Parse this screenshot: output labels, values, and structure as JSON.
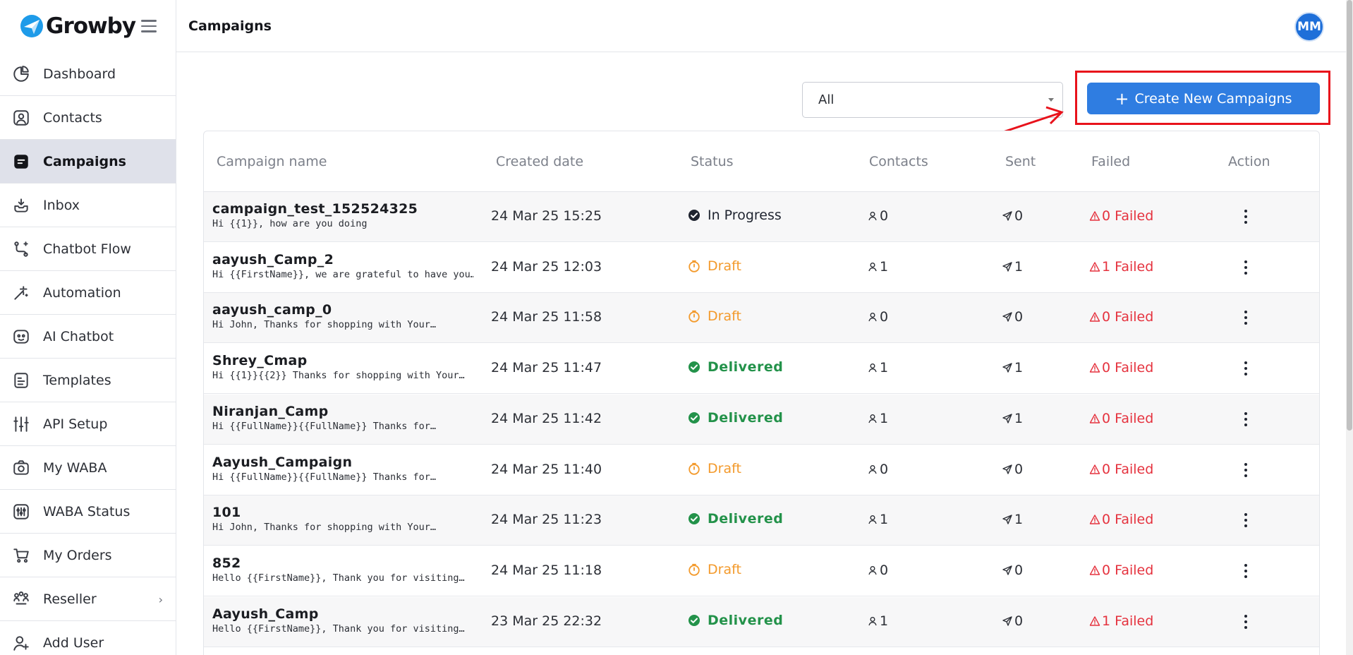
{
  "brand": {
    "name": "Growby",
    "logo_icon": "growby-logo-icon"
  },
  "sidebar": {
    "items": [
      {
        "label": "Dashboard",
        "icon": "dashboard-icon"
      },
      {
        "label": "Contacts",
        "icon": "contacts-icon"
      },
      {
        "label": "Campaigns",
        "icon": "campaigns-icon",
        "active": true
      },
      {
        "label": "Inbox",
        "icon": "inbox-icon"
      },
      {
        "label": "Chatbot Flow",
        "icon": "chatbot-flow-icon"
      },
      {
        "label": "Automation",
        "icon": "automation-icon"
      },
      {
        "label": "AI Chatbot",
        "icon": "ai-chatbot-icon"
      },
      {
        "label": "Templates",
        "icon": "templates-icon"
      },
      {
        "label": "API Setup",
        "icon": "api-setup-icon"
      },
      {
        "label": "My WABA",
        "icon": "my-waba-icon"
      },
      {
        "label": "WABA Status",
        "icon": "waba-status-icon"
      },
      {
        "label": "My Orders",
        "icon": "my-orders-icon"
      },
      {
        "label": "Reseller",
        "icon": "reseller-icon"
      },
      {
        "label": "Add User",
        "icon": "add-user-icon"
      }
    ]
  },
  "header": {
    "title": "Campaigns",
    "avatar_initials": "MM"
  },
  "filter": {
    "selected": "All"
  },
  "create_button": {
    "label": "Create New Campaigns",
    "plus": "+"
  },
  "table": {
    "headers": [
      "Campaign name",
      "Created date",
      "Status",
      "Contacts",
      "Sent",
      "Failed",
      "Action"
    ],
    "rows": [
      {
        "name": "campaign_test_152524325",
        "message": "Hi {{1}}, how are you doing",
        "date": "24 Mar 25 15:25",
        "status": "In Progress",
        "contacts": "0",
        "sent": "0",
        "failed": "0 Failed"
      },
      {
        "name": "aayush_Camp_2",
        "message": "Hi {{FirstName}}, we are grateful to have you…",
        "date": "24 Mar 25 12:03",
        "status": "Draft",
        "contacts": "1",
        "sent": "1",
        "failed": "1 Failed"
      },
      {
        "name": "aayush_camp_0",
        "message": "Hi John, Thanks for shopping with Your…",
        "date": "24 Mar 25 11:58",
        "status": "Draft",
        "contacts": "0",
        "sent": "0",
        "failed": "0 Failed"
      },
      {
        "name": "Shrey_Cmap",
        "message": "Hi {{1}}{{2}} Thanks for shopping with Your…",
        "date": "24 Mar 25 11:47",
        "status": "Delivered",
        "contacts": "1",
        "sent": "1",
        "failed": "0 Failed"
      },
      {
        "name": "Niranjan_Camp",
        "message": "Hi {{FullName}}{{FullName}} Thanks for…",
        "date": "24 Mar 25 11:42",
        "status": "Delivered",
        "contacts": "1",
        "sent": "1",
        "failed": "0 Failed"
      },
      {
        "name": "Aayush_Campaign",
        "message": "Hi {{FullName}}{{FullName}} Thanks for…",
        "date": "24 Mar 25 11:40",
        "status": "Draft",
        "contacts": "0",
        "sent": "0",
        "failed": "0 Failed"
      },
      {
        "name": "101",
        "message": "Hi John, Thanks for shopping with Your…",
        "date": "24 Mar 25 11:23",
        "status": "Delivered",
        "contacts": "1",
        "sent": "1",
        "failed": "0 Failed"
      },
      {
        "name": "852",
        "message": "Hello {{FirstName}}, Thank you for visiting…",
        "date": "24 Mar 25 11:18",
        "status": "Draft",
        "contacts": "0",
        "sent": "0",
        "failed": "0 Failed"
      },
      {
        "name": "Aayush_Camp",
        "message": "Hello {{FirstName}}, Thank you for visiting…",
        "date": "23 Mar 25 22:32",
        "status": "Delivered",
        "contacts": "1",
        "sent": "0",
        "failed": "1 Failed"
      }
    ]
  },
  "colors": {
    "accent": "#2f7de1",
    "active_nav": "#dfe1ea",
    "draft": "#f39a2c",
    "delivered": "#23924a",
    "failed": "#e5323e",
    "highlight": "#e8121b"
  }
}
